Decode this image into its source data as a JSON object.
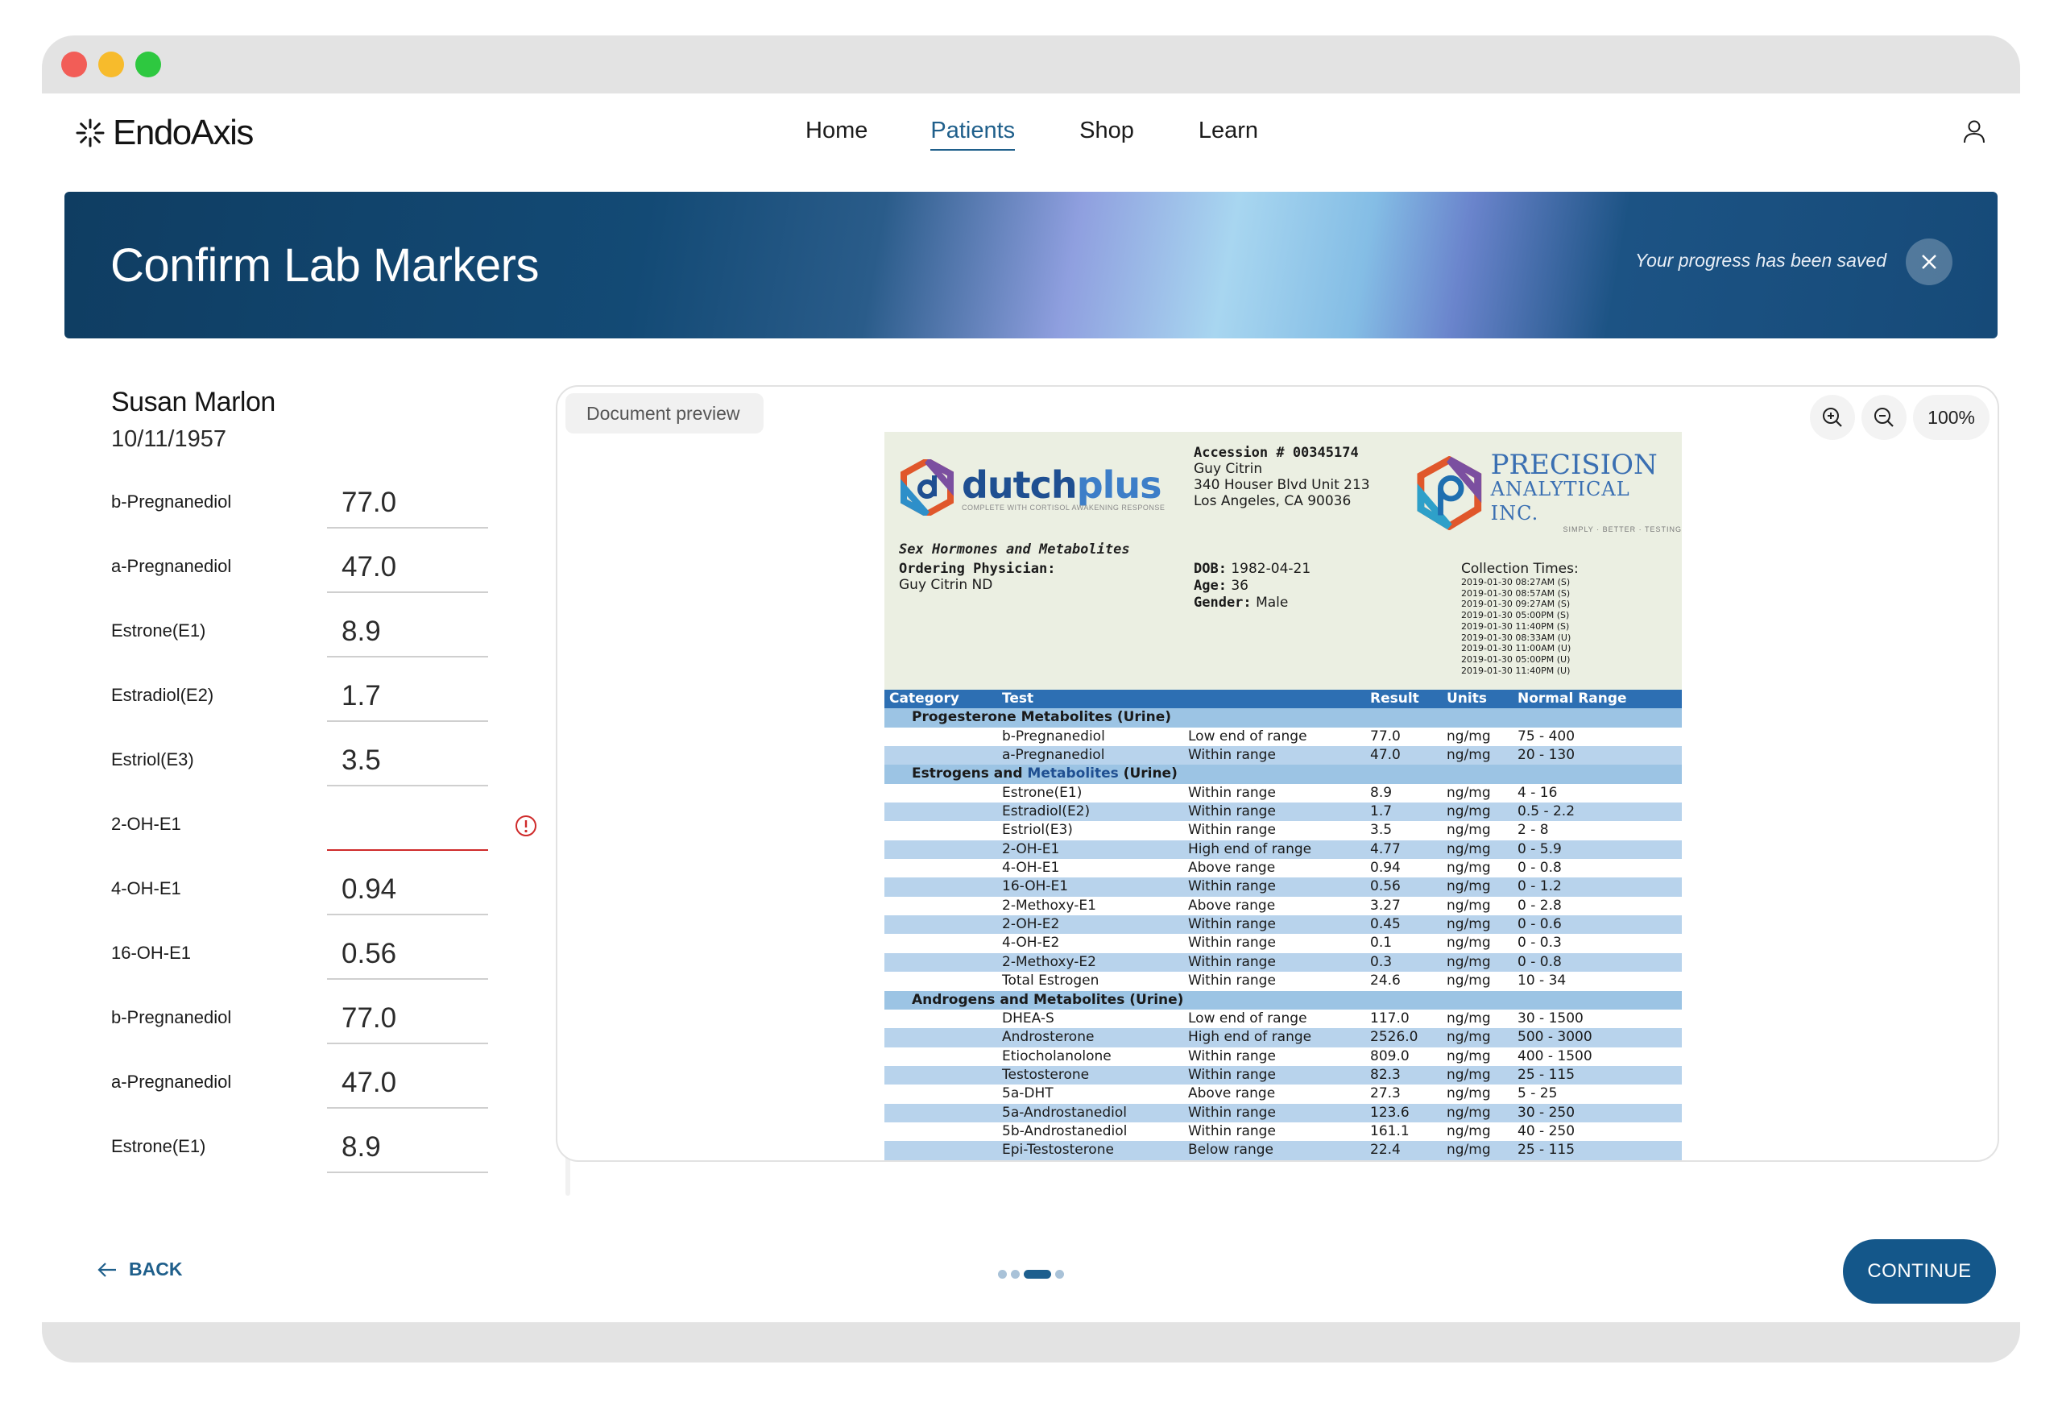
{
  "app": {
    "brand": "EndoAxis",
    "nav": [
      {
        "label": "Home",
        "active": false
      },
      {
        "label": "Patients",
        "active": true
      },
      {
        "label": "Shop",
        "active": false
      },
      {
        "label": "Learn",
        "active": false
      }
    ]
  },
  "banner": {
    "title": "Confirm Lab Markers",
    "saved_message": "Your progress has been saved"
  },
  "patient": {
    "name": "Susan Marlon",
    "dob": "10/11/1957"
  },
  "markers": [
    {
      "label": "b-Pregnanediol",
      "value": "77.0"
    },
    {
      "label": "a-Pregnanediol",
      "value": "47.0"
    },
    {
      "label": "Estrone(E1)",
      "value": "8.9"
    },
    {
      "label": "Estradiol(E2)",
      "value": "1.7"
    },
    {
      "label": "Estriol(E3)",
      "value": "3.5"
    },
    {
      "label": "2-OH-E1",
      "value": "",
      "error": true
    },
    {
      "label": "4-OH-E1",
      "value": "0.94"
    },
    {
      "label": "16-OH-E1",
      "value": "0.56"
    },
    {
      "label": "b-Pregnanediol",
      "value": "77.0"
    },
    {
      "label": "a-Pregnanediol",
      "value": "47.0"
    },
    {
      "label": "Estrone(E1)",
      "value": "8.9"
    }
  ],
  "preview": {
    "tab_label": "Document preview",
    "zoom_level": "100%"
  },
  "report": {
    "brand_left": "dutch",
    "brand_left_plus": "plus",
    "brand_left_sub": "COMPLETE WITH CORTISOL AWAKENING RESPONSE",
    "accession": "Accession # 00345174",
    "patient_name": "Guy Citrin",
    "address1": "340 Houser Blvd Unit 213",
    "address2": "Los Angeles, CA 90036",
    "brand_right": "PRECISION",
    "brand_right_sub": "ANALYTICAL INC.",
    "brand_right_tag": "SIMPLY · BETTER · TESTING",
    "subtitle": "Sex Hormones and Metabolites",
    "physician_label": "Ordering Physician:",
    "physician": "Guy Citrin ND",
    "dob_label": "DOB:",
    "dob": "1982-04-21",
    "age_label": "Age:",
    "age": "36",
    "gender_label": "Gender:",
    "gender": "Male",
    "collection_label": "Collection Times:",
    "collection_times": [
      "2019-01-30 08:27AM (S)",
      "2019-01-30 08:57AM (S)",
      "2019-01-30 09:27AM (S)",
      "2019-01-30 05:00PM (S)",
      "2019-01-30 11:40PM (S)",
      "2019-01-30 08:33AM (U)",
      "2019-01-30 11:00AM (U)",
      "2019-01-30 05:00PM (U)",
      "2019-01-30 11:40PM (U)"
    ],
    "columns": {
      "category": "Category",
      "test": "Test",
      "result": "Result",
      "units": "Units",
      "range": "Normal Range"
    },
    "rows": [
      {
        "type": "cat",
        "parts": [
          "Progesterone Metabolites (Urine)"
        ]
      },
      {
        "test": "b-Pregnanediol",
        "result": "Low end of range",
        "value": "77.0",
        "unit": "ng/mg",
        "range": "75 - 400"
      },
      {
        "test": "a-Pregnanediol",
        "result": "Within range",
        "value": "47.0",
        "unit": "ng/mg",
        "range": "20 - 130"
      },
      {
        "type": "cat",
        "parts": [
          "Estrogens and ",
          "Metabolites",
          " (Urine)"
        ]
      },
      {
        "test": "Estrone(E1)",
        "result": "Within range",
        "value": "8.9",
        "unit": "ng/mg",
        "range": "4 - 16"
      },
      {
        "test": "Estradiol(E2)",
        "result": "Within range",
        "value": "1.7",
        "unit": "ng/mg",
        "range": "0.5 - 2.2"
      },
      {
        "test": "Estriol(E3)",
        "result": "Within range",
        "value": "3.5",
        "unit": "ng/mg",
        "range": "2 - 8"
      },
      {
        "test": "2-OH-E1",
        "result": "High end of range",
        "value": "4.77",
        "unit": "ng/mg",
        "range": "0 - 5.9"
      },
      {
        "test": "4-OH-E1",
        "result": "Above range",
        "value": "0.94",
        "unit": "ng/mg",
        "range": "0 - 0.8"
      },
      {
        "test": "16-OH-E1",
        "result": "Within range",
        "value": "0.56",
        "unit": "ng/mg",
        "range": "0 - 1.2"
      },
      {
        "test": "2-Methoxy-E1",
        "result": "Above range",
        "value": "3.27",
        "unit": "ng/mg",
        "range": "0 - 2.8"
      },
      {
        "test": "2-OH-E2",
        "result": "Within range",
        "value": "0.45",
        "unit": "ng/mg",
        "range": "0 - 0.6"
      },
      {
        "test": "4-OH-E2",
        "result": "Within range",
        "value": "0.1",
        "unit": "ng/mg",
        "range": "0 - 0.3"
      },
      {
        "test": "2-Methoxy-E2",
        "result": "Within range",
        "value": "0.3",
        "unit": "ng/mg",
        "range": "0 - 0.8"
      },
      {
        "test": "Total Estrogen",
        "result": "Within range",
        "value": "24.6",
        "unit": "ng/mg",
        "range": "10 - 34"
      },
      {
        "type": "cat",
        "parts": [
          "Androgens and Metabolites (Urine)"
        ]
      },
      {
        "test": "DHEA-S",
        "result": "Low end of range",
        "value": "117.0",
        "unit": "ng/mg",
        "range": "30 - 1500"
      },
      {
        "test": "Androsterone",
        "result": "High end of range",
        "value": "2526.0",
        "unit": "ng/mg",
        "range": "500 - 3000"
      },
      {
        "test": "Etiocholanolone",
        "result": "Within range",
        "value": "809.0",
        "unit": "ng/mg",
        "range": "400 - 1500"
      },
      {
        "test": "Testosterone",
        "result": "Within range",
        "value": "82.3",
        "unit": "ng/mg",
        "range": "25 - 115"
      },
      {
        "test": "5a-DHT",
        "result": "Above range",
        "value": "27.3",
        "unit": "ng/mg",
        "range": "5 - 25"
      },
      {
        "test": "5a-Androstanediol",
        "result": "Within range",
        "value": "123.6",
        "unit": "ng/mg",
        "range": "30 - 250"
      },
      {
        "test": "5b-Androstanediol",
        "result": "Within range",
        "value": "161.1",
        "unit": "ng/mg",
        "range": "40 - 250"
      },
      {
        "test": "Epi-Testosterone",
        "result": "Below range",
        "value": "22.4",
        "unit": "ng/mg",
        "range": "25 - 115"
      }
    ]
  },
  "footer": {
    "back_label": "BACK",
    "continue_label": "CONTINUE",
    "steps_total": 4,
    "current_step": 3
  },
  "colors": {
    "accent": "#14578a",
    "error": "#cf2b2b",
    "table_header": "#2d6fb3",
    "table_alt_row": "#b8d3ec"
  }
}
